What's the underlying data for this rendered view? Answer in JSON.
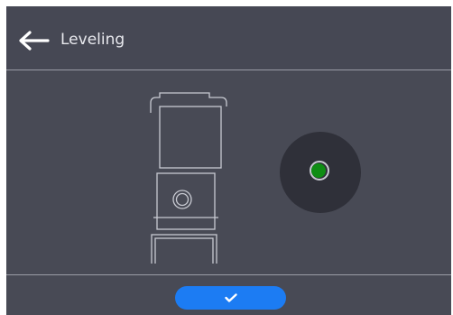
{
  "header": {
    "title": "Leveling",
    "back_icon": "arrow-left-icon"
  },
  "level_indicator": {
    "status": "level",
    "bubble_color": "#0f8d14",
    "background_color": "#2f3039"
  },
  "device_icon": "balance-device-icon",
  "footer": {
    "confirm_icon": "checkmark-icon",
    "confirm_color": "#1c7cf3"
  }
}
